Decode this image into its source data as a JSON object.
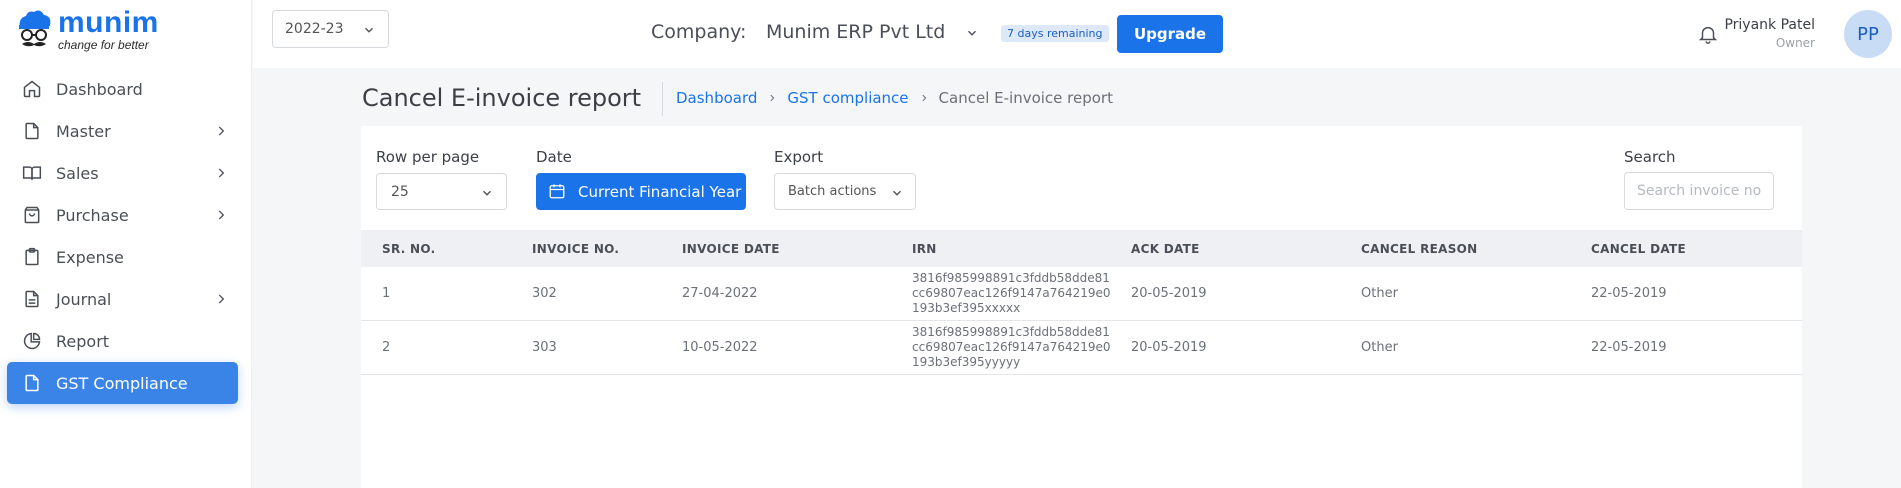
{
  "brand": {
    "name": "munim",
    "tagline": "change for better"
  },
  "sidebar": {
    "items": [
      {
        "label": "Dashboard",
        "icon": "home-icon",
        "has_children": false
      },
      {
        "label": "Master",
        "icon": "file-icon",
        "has_children": true
      },
      {
        "label": "Sales",
        "icon": "book-icon",
        "has_children": true
      },
      {
        "label": "Purchase",
        "icon": "shopping-bag-icon",
        "has_children": true
      },
      {
        "label": "Expense",
        "icon": "clipboard-icon",
        "has_children": false
      },
      {
        "label": "Journal",
        "icon": "document-icon",
        "has_children": true
      },
      {
        "label": "Report",
        "icon": "pie-chart-icon",
        "has_children": false
      },
      {
        "label": "GST Compliance",
        "icon": "file-icon",
        "has_children": false,
        "active": true
      }
    ]
  },
  "header": {
    "year": "2022-23",
    "company_label": "Company:",
    "company_name": "Munim ERP Pvt Ltd",
    "trial_badge": "7 days remaining",
    "upgrade_label": "Upgrade",
    "user": {
      "name": "Priyank Patel",
      "role": "Owner",
      "initials": "PP"
    }
  },
  "page": {
    "title": "Cancel E-invoice report",
    "breadcrumb": [
      "Dashboard",
      "GST compliance",
      "Cancel E-invoice report"
    ]
  },
  "controls": {
    "rows_label": "Row per page",
    "rows_value": "25",
    "date_label": "Date",
    "date_value": "Current Financial Year",
    "export_label": "Export",
    "export_value": "Batch actions",
    "search_label": "Search",
    "search_placeholder": "Search invoice no."
  },
  "table": {
    "columns": [
      "SR. NO.",
      "INVOICE NO.",
      "INVOICE DATE",
      "IRN",
      "ACK DATE",
      "CANCEL REASON",
      "CANCEL DATE"
    ],
    "rows": [
      {
        "sr": "1",
        "invoice_no": "302",
        "invoice_date": "27-04-2022",
        "irn": "3816f985998891c3fddb58dde81cc69807eac126f9147a764219e0193b3ef395xxxxx",
        "ack_date": "20-05-2019",
        "cancel_reason": "Other",
        "cancel_date": "22-05-2019"
      },
      {
        "sr": "2",
        "invoice_no": "303",
        "invoice_date": "10-05-2022",
        "irn": "3816f985998891c3fddb58dde81cc69807eac126f9147a764219e0193b3ef395yyyyy",
        "ack_date": "20-05-2019",
        "cancel_reason": "Other",
        "cancel_date": "22-05-2019"
      }
    ]
  },
  "colors": {
    "primary": "#1a73e8",
    "active_nav": "#3a84e8",
    "table_header": "#eef0f4"
  }
}
